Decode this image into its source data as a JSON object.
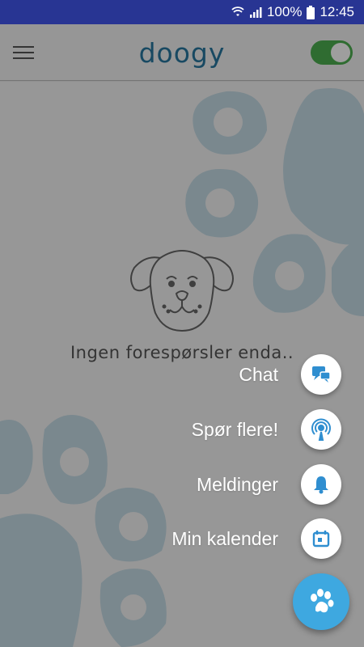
{
  "status_bar": {
    "battery": "100%",
    "time": "12:45",
    "icons": [
      "wifi-icon",
      "signal-icon",
      "battery-icon"
    ]
  },
  "app_bar": {
    "logo": "doogy",
    "toggle_on": true,
    "accent": "#27779e",
    "toggle_color": "#4caf50"
  },
  "empty_state": {
    "message": "Ingen forespørsler enda.."
  },
  "fab_menu": {
    "items": [
      {
        "label": "Chat",
        "icon": "chat-icon"
      },
      {
        "label": "Spør flere!",
        "icon": "broadcast-icon"
      },
      {
        "label": "Meldinger",
        "icon": "bell-icon"
      },
      {
        "label": "Min kalender",
        "icon": "calendar-icon"
      }
    ],
    "main_icon": "paw-icon",
    "fab_color": "#3ea8e0"
  }
}
